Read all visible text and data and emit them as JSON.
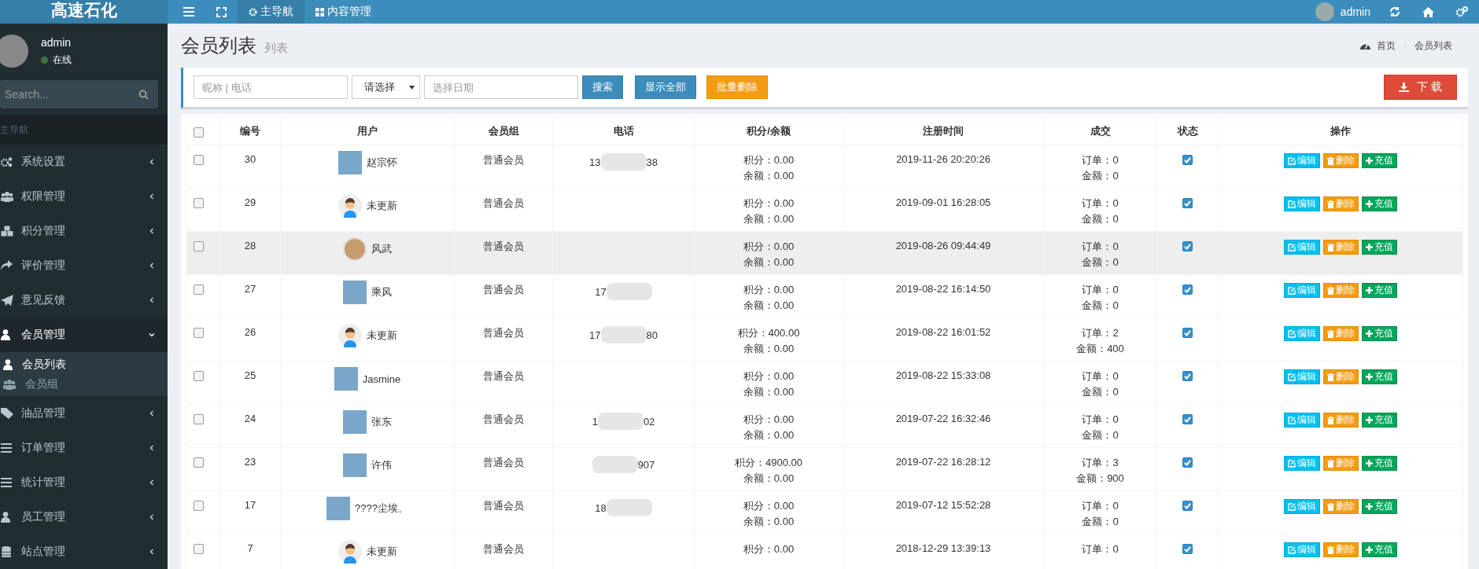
{
  "logo": "高速石化",
  "nav_tabs": [
    {
      "label": "主导航",
      "selected": true
    },
    {
      "label": "内容管理",
      "selected": false
    }
  ],
  "top_user": "admin",
  "sidebar": {
    "user": {
      "name": "admin",
      "status": "在线"
    },
    "search": {
      "placeholder": "Search..."
    },
    "header": "主导航",
    "items": [
      {
        "label": "系统设置",
        "expanded": false
      },
      {
        "label": "权限管理",
        "expanded": false
      },
      {
        "label": "积分管理",
        "expanded": false
      },
      {
        "label": "评价管理",
        "expanded": false
      },
      {
        "label": "意见反馈",
        "expanded": false
      },
      {
        "label": "会员管理",
        "expanded": true,
        "children": [
          {
            "label": "会员列表",
            "selected": true
          },
          {
            "label": "会员组",
            "selected": false
          }
        ]
      },
      {
        "label": "油品管理",
        "expanded": false
      },
      {
        "label": "订单管理",
        "expanded": false
      },
      {
        "label": "统计管理",
        "expanded": false
      },
      {
        "label": "员工管理",
        "expanded": false
      },
      {
        "label": "站点管理",
        "expanded": false
      }
    ]
  },
  "page": {
    "title": "会员列表",
    "subtitle": "列表",
    "breadcrumb": [
      "首页",
      "会员列表"
    ]
  },
  "filters": {
    "keyword_placeholder": "昵称 | 电话",
    "select_value": "请选择",
    "date_placeholder": "选择日期",
    "buttons": [
      {
        "kind": "search",
        "label": "搜索"
      },
      {
        "kind": "all",
        "label": "显示全部"
      },
      {
        "kind": "batch",
        "label": "批量删除"
      }
    ],
    "download": "下 载"
  },
  "table": {
    "select_all": false,
    "columns": [
      "编号",
      "用户",
      "会员组",
      "电话",
      "积分/余额",
      "注册时间",
      "成交",
      "状态",
      "操作"
    ],
    "rows": [
      {
        "selected": false,
        "highlighted": false,
        "id": "30",
        "avatar": {
          "kind": "photo"
        },
        "name": "赵宗怀",
        "group": "普通会员",
        "phone": {
          "start": "13",
          "end": "38"
        },
        "points": "积分：0.00",
        "balance": "余额：0.00",
        "time": "2019-11-26 20:20:26",
        "orders": "订单：0",
        "amount": "金额：0",
        "status": true,
        "actions": [
          {
            "kind": "edit",
            "label": "编辑"
          },
          {
            "kind": "delete",
            "label": "删除"
          },
          {
            "kind": "recharge",
            "label": "充值"
          }
        ]
      },
      {
        "selected": false,
        "highlighted": false,
        "id": "29",
        "avatar": {
          "kind": "default"
        },
        "name": "未更新",
        "group": "普通会员",
        "points": "积分：0.00",
        "balance": "余额：0.00",
        "time": "2019-09-01 16:28:05",
        "orders": "订单：0",
        "amount": "金额：0",
        "status": true,
        "actions": [
          {
            "kind": "edit",
            "label": "编辑"
          },
          {
            "kind": "delete",
            "label": "删除"
          },
          {
            "kind": "recharge",
            "label": "充值"
          }
        ]
      },
      {
        "selected": false,
        "highlighted": true,
        "id": "28",
        "avatar": {
          "kind": "round"
        },
        "name": "风武",
        "group": "普通会员",
        "points": "积分：0.00",
        "balance": "余额：0.00",
        "time": "2019-08-26 09:44:49",
        "orders": "订单：0",
        "amount": "金额：0",
        "status": true,
        "actions": [
          {
            "kind": "edit",
            "label": "编辑"
          },
          {
            "kind": "delete",
            "label": "删除"
          },
          {
            "kind": "recharge",
            "label": "充值"
          }
        ]
      },
      {
        "selected": false,
        "highlighted": false,
        "id": "27",
        "avatar": {
          "kind": "photo"
        },
        "name": "乘风",
        "group": "普通会员",
        "phone": {
          "start": "17"
        },
        "points": "积分：0.00",
        "balance": "余额：0.00",
        "time": "2019-08-22 16:14:50",
        "orders": "订单：0",
        "amount": "金额：0",
        "status": true,
        "actions": [
          {
            "kind": "edit",
            "label": "编辑"
          },
          {
            "kind": "delete",
            "label": "删除"
          },
          {
            "kind": "recharge",
            "label": "充值"
          }
        ]
      },
      {
        "selected": false,
        "highlighted": false,
        "id": "26",
        "avatar": {
          "kind": "default"
        },
        "name": "未更新",
        "group": "普通会员",
        "phone": {
          "start": "17",
          "end": "80"
        },
        "points": "积分：400.00",
        "balance": "余额：0.00",
        "time": "2019-08-22 16:01:52",
        "orders": "订单：2",
        "amount": "金额：400",
        "status": true,
        "actions": [
          {
            "kind": "edit",
            "label": "编辑"
          },
          {
            "kind": "delete",
            "label": "删除"
          },
          {
            "kind": "recharge",
            "label": "充值"
          }
        ]
      },
      {
        "selected": false,
        "highlighted": false,
        "id": "25",
        "avatar": {
          "kind": "photo"
        },
        "name": "Jasmine",
        "group": "普通会员",
        "points": "积分：0.00",
        "balance": "余额：0.00",
        "time": "2019-08-22 15:33:08",
        "orders": "订单：0",
        "amount": "金额：0",
        "status": true,
        "actions": [
          {
            "kind": "edit",
            "label": "编辑"
          },
          {
            "kind": "delete",
            "label": "删除"
          },
          {
            "kind": "recharge",
            "label": "充值"
          }
        ]
      },
      {
        "selected": false,
        "highlighted": false,
        "id": "24",
        "avatar": {
          "kind": "photo"
        },
        "name": "张东",
        "group": "普通会员",
        "phone": {
          "start": "1",
          "end": "02"
        },
        "points": "积分：0.00",
        "balance": "余额：0.00",
        "time": "2019-07-22 16:32:46",
        "orders": "订单：0",
        "amount": "金额：0",
        "status": true,
        "actions": [
          {
            "kind": "edit",
            "label": "编辑"
          },
          {
            "kind": "delete",
            "label": "删除"
          },
          {
            "kind": "recharge",
            "label": "充值"
          }
        ]
      },
      {
        "selected": false,
        "highlighted": false,
        "id": "23",
        "avatar": {
          "kind": "photo"
        },
        "name": "许伟",
        "group": "普通会员",
        "phone": {
          "end": "907"
        },
        "points": "积分：4900.00",
        "balance": "余额：0.00",
        "time": "2019-07-22 16:28:12",
        "orders": "订单：3",
        "amount": "金额：900",
        "status": true,
        "actions": [
          {
            "kind": "edit",
            "label": "编辑"
          },
          {
            "kind": "delete",
            "label": "删除"
          },
          {
            "kind": "recharge",
            "label": "充值"
          }
        ]
      },
      {
        "selected": false,
        "highlighted": false,
        "id": "17",
        "avatar": {
          "kind": "photo"
        },
        "name": "????尘埃。",
        "group": "普通会员",
        "phone": {
          "start": "18"
        },
        "points": "积分：0.00",
        "balance": "余额：0.00",
        "time": "2019-07-12 15:52:28",
        "orders": "订单：0",
        "amount": "金额：0",
        "status": true,
        "actions": [
          {
            "kind": "edit",
            "label": "编辑"
          },
          {
            "kind": "delete",
            "label": "删除"
          },
          {
            "kind": "recharge",
            "label": "充值"
          }
        ]
      },
      {
        "selected": false,
        "highlighted": false,
        "id": "7",
        "avatar": {
          "kind": "default"
        },
        "name": "未更新",
        "group": "普通会员",
        "points": "积分：0.00",
        "time": "2018-12-29 13:39:13",
        "orders": "订单：0",
        "status": true,
        "actions": [
          {
            "kind": "edit",
            "label": "编辑"
          },
          {
            "kind": "delete",
            "label": "删除"
          },
          {
            "kind": "recharge",
            "label": "充值"
          }
        ]
      }
    ]
  }
}
